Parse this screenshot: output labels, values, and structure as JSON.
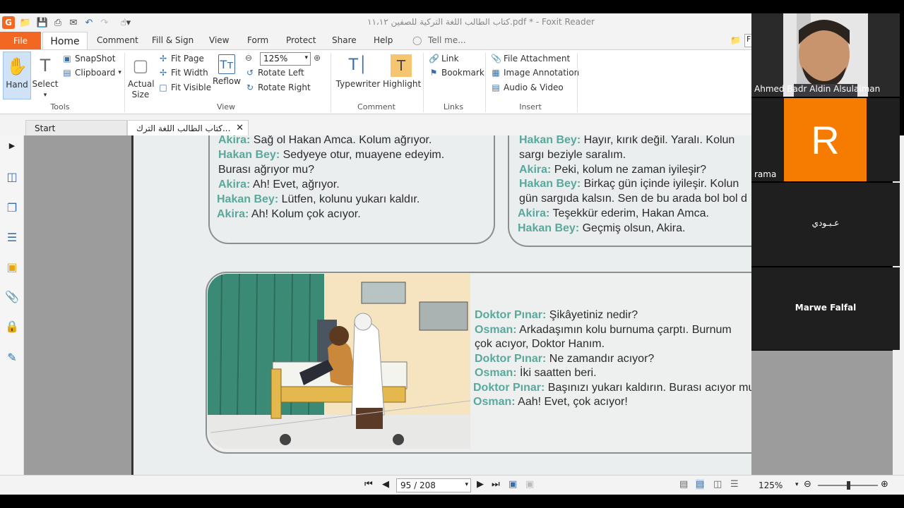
{
  "titlebar": {
    "title": "كتاب الطالب اللغة التركية للصفين ١١،١٢.pdf * - Foxit Reader"
  },
  "menu": {
    "file": "File",
    "home": "Home",
    "items": [
      "Comment",
      "Fill & Sign",
      "View",
      "Form",
      "Protect",
      "Share",
      "Help"
    ],
    "tell_me": "Tell me..."
  },
  "ribbon": {
    "hand": "Hand",
    "select": "Select",
    "snapshot": "SnapShot",
    "clipboard": "Clipboard",
    "tools_group": "Tools",
    "actual_size": "Actual Size",
    "fit_page": "Fit Page",
    "fit_width": "Fit Width",
    "fit_visible": "Fit Visible",
    "reflow": "Reflow",
    "zoom_value": "125%",
    "rotate_left": "Rotate Left",
    "rotate_right": "Rotate Right",
    "view_group": "View",
    "typewriter": "Typewriter",
    "highlight": "Highlight",
    "comment_group": "Comment",
    "link": "Link",
    "bookmark": "Bookmark",
    "links_group": "Links",
    "file_attachment": "File Attachment",
    "image_annotation": "Image Annotation",
    "audio_video": "Audio & Video",
    "insert_group": "Insert"
  },
  "tabs": {
    "start": "Start",
    "doc": "...كتاب الطالب اللغة الترك"
  },
  "document": {
    "left_dialog": [
      {
        "speaker": "Akira:",
        "text": " Sağ ol Hakan Amca. Kolum ağrıyor."
      },
      {
        "speaker": "Hakan Bey:",
        "text": " Sedyeye otur, muayene edeyim."
      },
      {
        "speaker": "",
        "text": "Burası ağrıyor mu?"
      },
      {
        "speaker": "Akira:",
        "text": " Ah! Evet, ağrıyor."
      },
      {
        "speaker": "Hakan Bey:",
        "text": " Lütfen, kolunu yukarı kaldır."
      },
      {
        "speaker": "Akira:",
        "text": " Ah! Kolum çok acıyor."
      }
    ],
    "right_dialog": [
      {
        "speaker": "Hakan Bey:",
        "text": " Hayır, kırık değil. Yaralı. Kolun"
      },
      {
        "speaker": "",
        "text": "sargı beziyle saralım."
      },
      {
        "speaker": "Akira:",
        "text": " Peki, kolum ne zaman iyileşir?"
      },
      {
        "speaker": "Hakan Bey:",
        "text": " Birkaç gün içinde iyileşir. Kolun"
      },
      {
        "speaker": "",
        "text": "gün sargıda kalsın. Sen de bu arada bol bol d"
      },
      {
        "speaker": "Akira:",
        "text": " Teşekkür ederim, Hakan Amca."
      },
      {
        "speaker": "Hakan Bey:",
        "text": " Geçmiş olsun, Akira."
      }
    ],
    "doctor_dialog": [
      {
        "speaker": "Doktor Pınar:",
        "text": " Şikâyetiniz nedir?"
      },
      {
        "speaker": "Osman:",
        "text": " Arkadaşımın kolu burnuma çarptı. Burnum"
      },
      {
        "speaker": "",
        "text": "çok acıyor, Doktor Hanım."
      },
      {
        "speaker": "Doktor Pınar:",
        "text": " Ne zamandır acıyor?"
      },
      {
        "speaker": "Osman:",
        "text": " İki saatten beri."
      },
      {
        "speaker": "Doktor Pınar:",
        "text": " Başınızı yukarı kaldırın. Burası acıyor mu?"
      },
      {
        "speaker": "Osman:",
        "text": " Aah! Evet, çok acıyor!"
      }
    ]
  },
  "statusbar": {
    "page_display": "95 / 208",
    "zoom": "125%"
  },
  "video_call": {
    "participants": [
      {
        "name": "Ahmed Badr Aldin Alsulaiman"
      },
      {
        "name": "rama",
        "initial": "R",
        "color": "#f57c00"
      },
      {
        "name": "عـبـودي"
      },
      {
        "name": "Marwe Falfal"
      }
    ]
  },
  "colors": {
    "accent": "#f26722",
    "speaker_teal": "#5aa89c",
    "avatar_orange": "#f57c00"
  }
}
